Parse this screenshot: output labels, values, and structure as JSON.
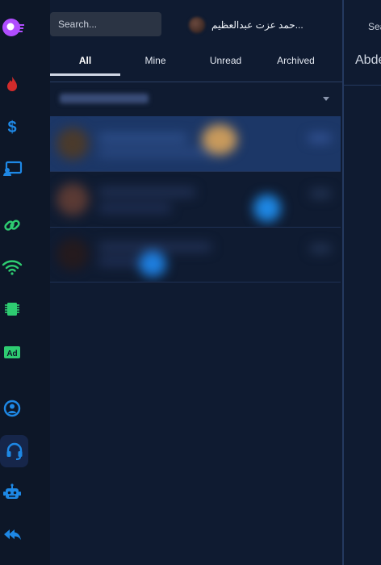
{
  "colors": {
    "accent": "#1e88e5",
    "selected_row": "#1c3767",
    "panel_bg": "#0f1b31",
    "rail_bg": "#0d1728"
  },
  "sidebar": {
    "items": [
      {
        "name": "app-logo-icon",
        "color": "#b04dff"
      },
      {
        "name": "flame-icon",
        "color": "#d12b2b"
      },
      {
        "name": "dollar-icon",
        "color": "#1e88e5"
      },
      {
        "name": "cast-icon",
        "color": "#1e88e5"
      },
      {
        "name": "link-icon",
        "color": "#2ecc71"
      },
      {
        "name": "wifi-icon",
        "color": "#2ecc71"
      },
      {
        "name": "chip-icon",
        "color": "#2ecc71"
      },
      {
        "name": "ad-icon",
        "color": "#2ecc71",
        "label": "Ad"
      },
      {
        "name": "user-icon",
        "color": "#1e88e5"
      },
      {
        "name": "headset-icon",
        "color": "#1e88e5",
        "active": true
      },
      {
        "name": "robot-icon",
        "color": "#1e88e5"
      },
      {
        "name": "reply-all-icon",
        "color": "#1e88e5"
      }
    ]
  },
  "search": {
    "placeholder": "Search..."
  },
  "agent": {
    "name": "...حمد عزت عبدالعظيم"
  },
  "tabs": [
    {
      "label": "All",
      "active": true
    },
    {
      "label": "Mine"
    },
    {
      "label": "Unread"
    },
    {
      "label": "Archived"
    }
  ],
  "right_panel": {
    "search_label": "Sea",
    "contact_name": "Abde"
  }
}
